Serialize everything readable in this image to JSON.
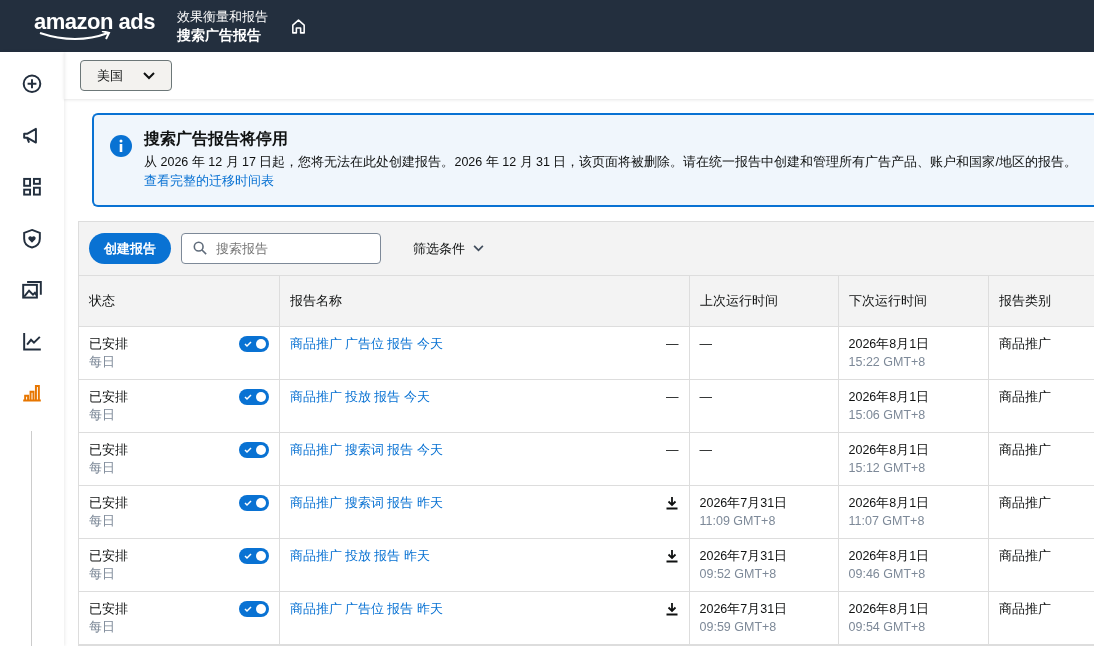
{
  "header": {
    "logo": "amazon ads",
    "breadcrumb_parent": "效果衡量和报告",
    "breadcrumb_current": "搜索广告报告"
  },
  "sidebar": {
    "items": [
      {
        "kind": "create",
        "selected": false
      },
      {
        "kind": "campaigns",
        "selected": false
      },
      {
        "kind": "dashboard",
        "selected": false
      },
      {
        "kind": "brand",
        "selected": false
      },
      {
        "kind": "creative",
        "selected": false
      },
      {
        "kind": "analytics",
        "selected": false
      },
      {
        "kind": "reports",
        "selected": true
      }
    ]
  },
  "country_select": {
    "value": "美国"
  },
  "alert": {
    "title": "搜索广告报告将停用",
    "message": "从 2026 年 12 月 17 日起，您将无法在此处创建报告。2026 年 12 月 31 日，该页面将被删除。请在统一报告中创建和管理所有广告产品、账户和国家/地区的报告。",
    "link": "查看完整的迁移时间表"
  },
  "toolbar": {
    "create_button": "创建报告",
    "search": {
      "placeholder": "搜索报告"
    },
    "filter": "筛选条件"
  },
  "table": {
    "columns": [
      "状态",
      "报告名称",
      "上次运行时间",
      "下次运行时间",
      "报告类别"
    ],
    "rows": [
      {
        "status": "已安排",
        "frequency": "每日",
        "on": true,
        "name": "商品推广 广告位 报告 今天",
        "action": {
          "kind": "dash",
          "text": "—"
        },
        "last_date": "—",
        "next_date": "2026年8月1日",
        "next_time": "15:22 GMT+8",
        "category": "商品推广"
      },
      {
        "status": "已安排",
        "frequency": "每日",
        "on": true,
        "name": "商品推广 投放 报告 今天",
        "action": {
          "kind": "dash",
          "text": "—"
        },
        "last_date": "—",
        "next_date": "2026年8月1日",
        "next_time": "15:06 GMT+8",
        "category": "商品推广"
      },
      {
        "status": "已安排",
        "frequency": "每日",
        "on": true,
        "name": "商品推广 搜索词 报告 今天",
        "action": {
          "kind": "dash",
          "text": "—"
        },
        "last_date": "—",
        "next_date": "2026年8月1日",
        "next_time": "15:12 GMT+8",
        "category": "商品推广"
      },
      {
        "status": "已安排",
        "frequency": "每日",
        "on": true,
        "name": "商品推广 搜索词 报告 昨天",
        "action": {
          "kind": "download"
        },
        "last_date": "2026年7月31日",
        "last_time": "11:09 GMT+8",
        "next_date": "2026年8月1日",
        "next_time": "11:07 GMT+8",
        "category": "商品推广"
      },
      {
        "status": "已安排",
        "frequency": "每日",
        "on": true,
        "name": "商品推广 投放 报告 昨天",
        "action": {
          "kind": "download"
        },
        "last_date": "2026年7月31日",
        "last_time": "09:52 GMT+8",
        "next_date": "2026年8月1日",
        "next_time": "09:46 GMT+8",
        "category": "商品推广"
      },
      {
        "status": "已安排",
        "frequency": "每日",
        "on": true,
        "name": "商品推广 广告位 报告 昨天",
        "action": {
          "kind": "download"
        },
        "last_date": "2026年7月31日",
        "last_time": "09:59 GMT+8",
        "next_date": "2026年8月1日",
        "next_time": "09:54 GMT+8",
        "category": "商品推广"
      }
    ]
  }
}
